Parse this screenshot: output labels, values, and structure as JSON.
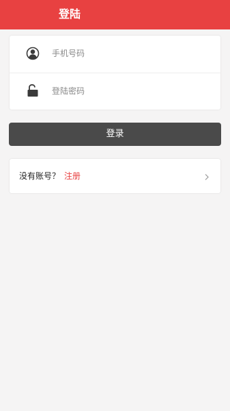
{
  "header": {
    "title": "登陆",
    "background_color": "#e84141"
  },
  "login_form": {
    "phone": {
      "placeholder": "手机号码",
      "value": "",
      "icon": "user-icon"
    },
    "password": {
      "placeholder": "登陆密码",
      "value": "",
      "icon": "lock-icon"
    }
  },
  "login_button": {
    "label": "登录",
    "background_color": "#4a4a4a"
  },
  "register": {
    "prompt": "没有账号？",
    "link_label": "注册",
    "link_color": "#e84141",
    "icon": "chevron-right-icon"
  }
}
